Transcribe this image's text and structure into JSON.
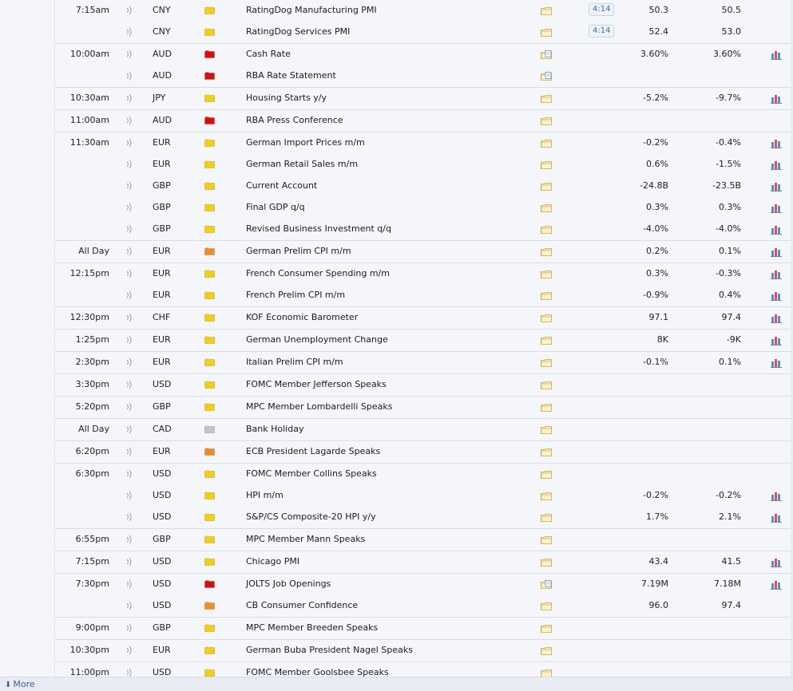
{
  "colors": {
    "impact_high": "#d80f0f",
    "impact_medium": "#f08c28",
    "impact_low": "#f2cf10",
    "impact_none": "#c4c4c4"
  },
  "icons": {
    "sound": "speaker-wave-icon",
    "impact": "impact-folder-icon",
    "detail": "folder-icon",
    "chart": "bar-chart-icon"
  },
  "more_label": "More",
  "events": [
    {
      "time": "7:15am",
      "currency": "CNY",
      "impact": "low",
      "title": "RatingDog Manufacturing PMI",
      "detail": "folder",
      "timer": "4:14",
      "actual": "50.3",
      "forecast": "50.5",
      "chart": false,
      "end": false
    },
    {
      "time": "",
      "currency": "CNY",
      "impact": "low",
      "title": "RatingDog Services PMI",
      "detail": "folder",
      "timer": "4:14",
      "actual": "52.4",
      "forecast": "53.0",
      "chart": false,
      "end": true
    },
    {
      "time": "10:00am",
      "currency": "AUD",
      "impact": "high",
      "title": "Cash Rate",
      "detail": "folder-doc",
      "timer": "",
      "actual": "3.60%",
      "forecast": "3.60%",
      "chart": true,
      "end": false
    },
    {
      "time": "",
      "currency": "AUD",
      "impact": "high",
      "title": "RBA Rate Statement",
      "detail": "folder-doc",
      "timer": "",
      "actual": "",
      "forecast": "",
      "chart": false,
      "end": true
    },
    {
      "time": "10:30am",
      "currency": "JPY",
      "impact": "low",
      "title": "Housing Starts y/y",
      "detail": "folder",
      "timer": "",
      "actual": "-5.2%",
      "forecast": "-9.7%",
      "chart": true,
      "end": true
    },
    {
      "time": "11:00am",
      "currency": "AUD",
      "impact": "high",
      "title": "RBA Press Conference",
      "detail": "folder",
      "timer": "",
      "actual": "",
      "forecast": "",
      "chart": false,
      "end": true
    },
    {
      "time": "11:30am",
      "currency": "EUR",
      "impact": "low",
      "title": "German Import Prices m/m",
      "detail": "folder",
      "timer": "",
      "actual": "-0.2%",
      "forecast": "-0.4%",
      "chart": true,
      "end": false
    },
    {
      "time": "",
      "currency": "EUR",
      "impact": "low",
      "title": "German Retail Sales m/m",
      "detail": "folder",
      "timer": "",
      "actual": "0.6%",
      "forecast": "-1.5%",
      "chart": true,
      "end": false
    },
    {
      "time": "",
      "currency": "GBP",
      "impact": "low",
      "title": "Current Account",
      "detail": "folder",
      "timer": "",
      "actual": "-24.8B",
      "forecast": "-23.5B",
      "chart": true,
      "end": false
    },
    {
      "time": "",
      "currency": "GBP",
      "impact": "low",
      "title": "Final GDP q/q",
      "detail": "folder",
      "timer": "",
      "actual": "0.3%",
      "forecast": "0.3%",
      "chart": true,
      "end": false
    },
    {
      "time": "",
      "currency": "GBP",
      "impact": "low",
      "title": "Revised Business Investment q/q",
      "detail": "folder",
      "timer": "",
      "actual": "-4.0%",
      "forecast": "-4.0%",
      "chart": true,
      "end": true
    },
    {
      "time": "All Day",
      "currency": "EUR",
      "impact": "medium",
      "title": "German Prelim CPI m/m",
      "detail": "folder",
      "timer": "",
      "actual": "0.2%",
      "forecast": "0.1%",
      "chart": true,
      "end": true
    },
    {
      "time": "12:15pm",
      "currency": "EUR",
      "impact": "low",
      "title": "French Consumer Spending m/m",
      "detail": "folder",
      "timer": "",
      "actual": "0.3%",
      "forecast": "-0.3%",
      "chart": true,
      "end": false
    },
    {
      "time": "",
      "currency": "EUR",
      "impact": "low",
      "title": "French Prelim CPI m/m",
      "detail": "folder",
      "timer": "",
      "actual": "-0.9%",
      "forecast": "0.4%",
      "chart": true,
      "end": true
    },
    {
      "time": "12:30pm",
      "currency": "CHF",
      "impact": "low",
      "title": "KOF Economic Barometer",
      "detail": "folder",
      "timer": "",
      "actual": "97.1",
      "forecast": "97.4",
      "chart": true,
      "end": true
    },
    {
      "time": "1:25pm",
      "currency": "EUR",
      "impact": "low",
      "title": "German Unemployment Change",
      "detail": "folder",
      "timer": "",
      "actual": "8K",
      "forecast": "-9K",
      "chart": true,
      "end": true
    },
    {
      "time": "2:30pm",
      "currency": "EUR",
      "impact": "low",
      "title": "Italian Prelim CPI m/m",
      "detail": "folder",
      "timer": "",
      "actual": "-0.1%",
      "forecast": "0.1%",
      "chart": true,
      "end": true
    },
    {
      "time": "3:30pm",
      "currency": "USD",
      "impact": "low",
      "title": "FOMC Member Jefferson Speaks",
      "detail": "folder",
      "timer": "",
      "actual": "",
      "forecast": "",
      "chart": false,
      "end": true
    },
    {
      "time": "5:20pm",
      "currency": "GBP",
      "impact": "low",
      "title": "MPC Member Lombardelli Speaks",
      "detail": "folder",
      "timer": "",
      "actual": "",
      "forecast": "",
      "chart": false,
      "end": true
    },
    {
      "time": "All Day",
      "currency": "CAD",
      "impact": "none",
      "title": "Bank Holiday",
      "detail": "folder",
      "timer": "",
      "actual": "",
      "forecast": "",
      "chart": false,
      "end": true
    },
    {
      "time": "6:20pm",
      "currency": "EUR",
      "impact": "medium",
      "title": "ECB President Lagarde Speaks",
      "detail": "folder",
      "timer": "",
      "actual": "",
      "forecast": "",
      "chart": false,
      "end": true
    },
    {
      "time": "6:30pm",
      "currency": "USD",
      "impact": "low",
      "title": "FOMC Member Collins Speaks",
      "detail": "folder",
      "timer": "",
      "actual": "",
      "forecast": "",
      "chart": false,
      "end": false
    },
    {
      "time": "",
      "currency": "USD",
      "impact": "low",
      "title": "HPI m/m",
      "detail": "folder",
      "timer": "",
      "actual": "-0.2%",
      "forecast": "-0.2%",
      "chart": true,
      "end": false
    },
    {
      "time": "",
      "currency": "USD",
      "impact": "low",
      "title": "S&P/CS Composite-20 HPI y/y",
      "detail": "folder",
      "timer": "",
      "actual": "1.7%",
      "forecast": "2.1%",
      "chart": true,
      "end": true
    },
    {
      "time": "6:55pm",
      "currency": "GBP",
      "impact": "low",
      "title": "MPC Member Mann Speaks",
      "detail": "folder",
      "timer": "",
      "actual": "",
      "forecast": "",
      "chart": false,
      "end": true
    },
    {
      "time": "7:15pm",
      "currency": "USD",
      "impact": "low",
      "title": "Chicago PMI",
      "detail": "folder",
      "timer": "",
      "actual": "43.4",
      "forecast": "41.5",
      "chart": true,
      "end": true
    },
    {
      "time": "7:30pm",
      "currency": "USD",
      "impact": "high",
      "title": "JOLTS Job Openings",
      "detail": "folder-doc",
      "timer": "",
      "actual": "7.19M",
      "forecast": "7.18M",
      "chart": true,
      "end": false
    },
    {
      "time": "",
      "currency": "USD",
      "impact": "medium",
      "title": "CB Consumer Confidence",
      "detail": "folder",
      "timer": "",
      "actual": "96.0",
      "forecast": "97.4",
      "chart": false,
      "end": true
    },
    {
      "time": "9:00pm",
      "currency": "GBP",
      "impact": "low",
      "title": "MPC Member Breeden Speaks",
      "detail": "folder",
      "timer": "",
      "actual": "",
      "forecast": "",
      "chart": false,
      "end": true
    },
    {
      "time": "10:30pm",
      "currency": "EUR",
      "impact": "low",
      "title": "German Buba President Nagel Speaks",
      "detail": "folder",
      "timer": "",
      "actual": "",
      "forecast": "",
      "chart": false,
      "end": true
    },
    {
      "time": "11:00pm",
      "currency": "USD",
      "impact": "low",
      "title": "FOMC Member Goolsbee Speaks",
      "detail": "folder",
      "timer": "",
      "actual": "",
      "forecast": "",
      "chart": false,
      "end": true
    }
  ]
}
